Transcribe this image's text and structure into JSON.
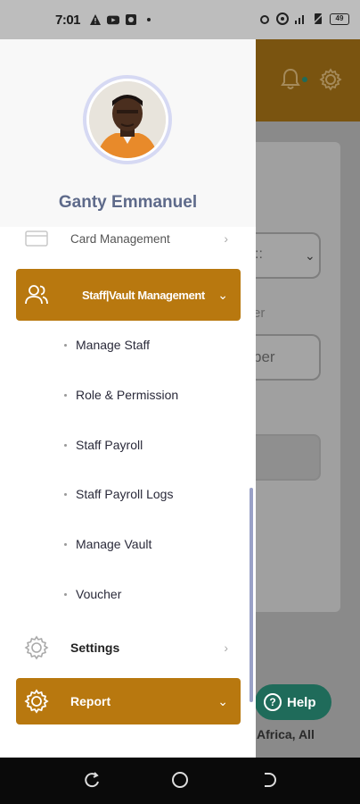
{
  "status_bar": {
    "time": "7:01",
    "battery": "49"
  },
  "background": {
    "select_text": "::",
    "field_label": "er",
    "input_placeholder": "ber",
    "help_label": "Help",
    "footer_text": "Africa, All"
  },
  "drawer": {
    "user_name": "Ganty Emmanuel",
    "items": {
      "card_management": "Card Management",
      "staff_vault": "Staff|Vault Management",
      "settings": "Settings",
      "report": "Report"
    },
    "submenu": [
      "Manage Staff",
      "Role & Permission",
      "Staff Payroll",
      "Staff Payroll Logs",
      "Manage Vault",
      "Voucher"
    ]
  },
  "colors": {
    "accent": "#b8780f",
    "help": "#1f6b5a",
    "name": "#5e6a8a"
  }
}
